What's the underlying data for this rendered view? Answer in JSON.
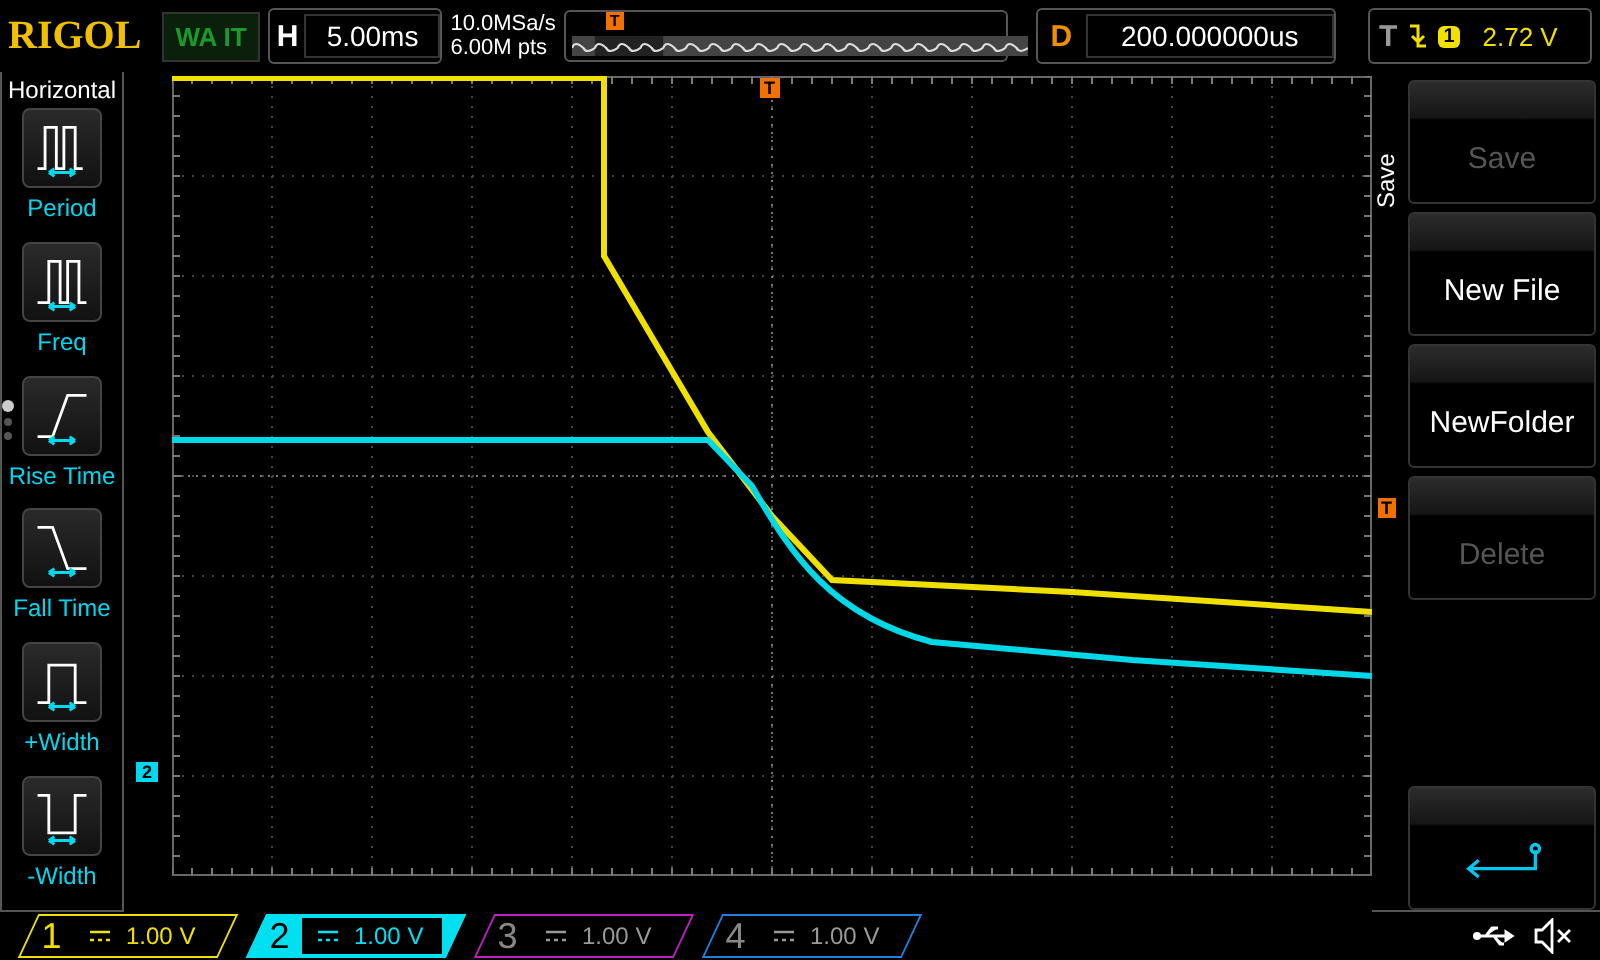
{
  "header": {
    "logo": "RIGOL",
    "status": "WA IT",
    "timebase": {
      "label": "H",
      "value": "5.00ms"
    },
    "sample_rate": "10.0MSa/s",
    "memory_depth": "6.00M pts",
    "position_marker": "T",
    "delay": {
      "label": "D",
      "value": "200.000000us"
    },
    "trigger": {
      "label": "T",
      "source": "1",
      "level": "2.72 V"
    }
  },
  "left_menu": {
    "title": "Horizontal",
    "items": [
      {
        "kind": "period",
        "label": "Period"
      },
      {
        "kind": "freq",
        "label": "Freq"
      },
      {
        "kind": "rise",
        "label": "Rise Time"
      },
      {
        "kind": "fall",
        "label": "Fall Time"
      },
      {
        "kind": "pwidth",
        "label": "+Width"
      },
      {
        "kind": "nwidth",
        "label": "-Width"
      }
    ],
    "pages": [
      {
        "selected": true
      },
      {
        "selected": false
      },
      {
        "selected": false
      }
    ]
  },
  "screen": {
    "trigger_marker": "T",
    "level_marker": "T",
    "channel_marker": "2"
  },
  "right_menu": {
    "title": "Save",
    "buttons": [
      {
        "kind": "text",
        "label": "Save",
        "disabled": true
      },
      {
        "kind": "text",
        "label": "New File",
        "disabled": false
      },
      {
        "kind": "text",
        "label": "NewFolder",
        "disabled": false
      },
      {
        "kind": "text",
        "label": "Delete",
        "disabled": true
      },
      {
        "kind": "back"
      }
    ]
  },
  "channels": [
    {
      "number": "1",
      "scale": "1.00 V",
      "on": true,
      "selected": false,
      "color": "#f0e000"
    },
    {
      "number": "2",
      "scale": "1.00 V",
      "on": true,
      "selected": true,
      "color": "#00e0f0"
    },
    {
      "number": "3",
      "scale": "1.00 V",
      "on": false,
      "selected": false,
      "color": "#c020c0"
    },
    {
      "number": "4",
      "scale": "1.00 V",
      "on": false,
      "selected": false,
      "color": "#2080e0"
    }
  ]
}
